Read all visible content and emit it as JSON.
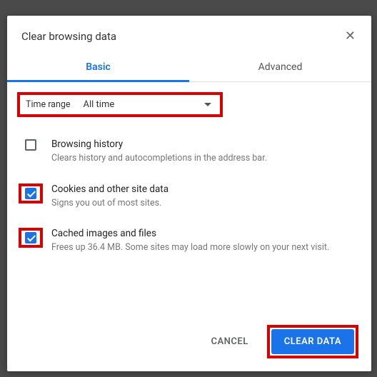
{
  "title": "Clear browsing data",
  "tabs": {
    "basic": "Basic",
    "advanced": "Advanced"
  },
  "time_range": {
    "label": "Time range",
    "value": "All time"
  },
  "options": [
    {
      "title": "Browsing history",
      "desc": "Clears history and autocompletions in the address bar.",
      "checked": false,
      "highlight": false
    },
    {
      "title": "Cookies and other site data",
      "desc": "Signs you out of most sites.",
      "checked": true,
      "highlight": true
    },
    {
      "title": "Cached images and files",
      "desc": "Frees up 36.4 MB. Some sites may load more slowly on your next visit.",
      "checked": true,
      "highlight": true
    }
  ],
  "buttons": {
    "cancel": "CANCEL",
    "clear": "CLEAR DATA"
  }
}
